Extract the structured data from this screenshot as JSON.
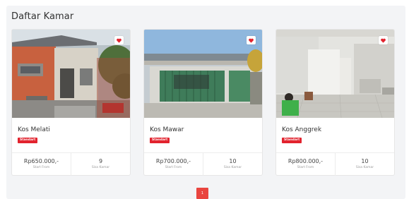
{
  "page": {
    "title": "Daftar Kamar"
  },
  "rooms": [
    {
      "name": "Kos Melati",
      "badge": "Standart",
      "price": "Rp650.000,-",
      "price_label": "Start From",
      "count": "9",
      "count_label": "Sisa Kamar",
      "photo": "house-orange-facade"
    },
    {
      "name": "Kos Mawar",
      "badge": "Standart",
      "price": "Rp700.000,-",
      "price_label": "Start From",
      "count": "10",
      "count_label": "Sisa Kamar",
      "photo": "house-green-fence"
    },
    {
      "name": "Kos Anggrek",
      "badge": "Standart",
      "price": "Rp800.000,-",
      "price_label": "Start From",
      "count": "10",
      "count_label": "Sisa Kamar",
      "photo": "white-interior-room"
    }
  ],
  "icons": {
    "favorite": "heart-icon"
  },
  "colors": {
    "accent": "#e2232e",
    "pagination": "#e9453f"
  },
  "pagination": {
    "current": "1"
  }
}
